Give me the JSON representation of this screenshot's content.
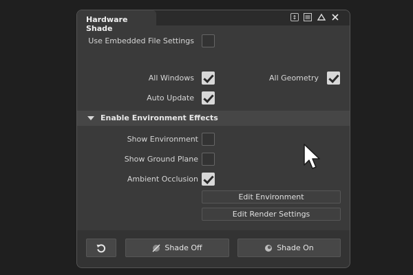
{
  "panel": {
    "tab_title": "Hardware Shade",
    "titlebar_icons": [
      "dock-toggle-icon",
      "menu-icon",
      "collapse-icon",
      "close-icon"
    ]
  },
  "settings": {
    "use_embedded_file_settings": {
      "label": "Use Embedded File Settings",
      "checked": false
    },
    "all_windows": {
      "label": "All Windows",
      "checked": true
    },
    "all_geometry": {
      "label": "All Geometry",
      "checked": true
    },
    "auto_update": {
      "label": "Auto Update",
      "checked": true
    }
  },
  "environment_section": {
    "title": "Enable Environment Effects",
    "expanded": true,
    "show_environment": {
      "label": "Show Environment",
      "checked": false
    },
    "show_ground_plane": {
      "label": "Show Ground Plane",
      "checked": false
    },
    "ambient_occlusion": {
      "label": "Ambient Occlusion",
      "checked": true
    },
    "edit_environment_label": "Edit Environment",
    "edit_render_settings_label": "Edit Render Settings"
  },
  "footer": {
    "reset_icon": "reset-icon",
    "shade_off_label": "Shade Off",
    "shade_on_label": "Shade On"
  },
  "colors": {
    "background": "#1f1f1f",
    "panel": "#3a3a3a",
    "section_header": "#464646",
    "checkbox_on": "#d8d8d8"
  }
}
